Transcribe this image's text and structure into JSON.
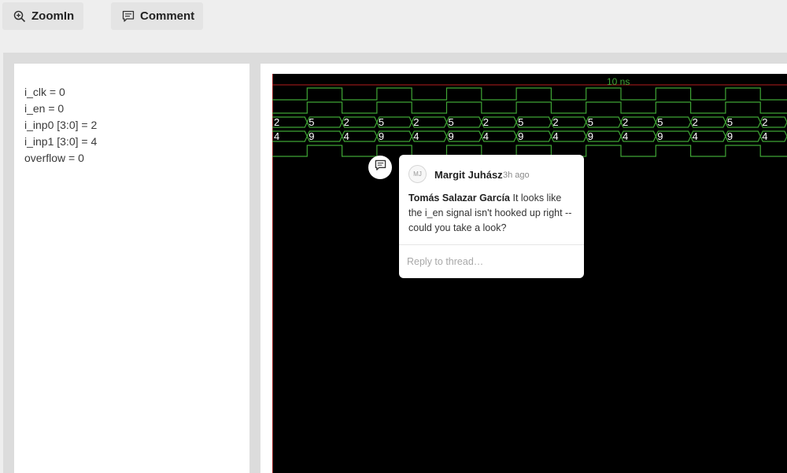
{
  "toolbar": {
    "zoom_label": "ZoomIn",
    "comment_label": "Comment"
  },
  "signals": [
    {
      "label": "i_clk = 0"
    },
    {
      "label": "i_en = 0"
    },
    {
      "label": "i_inp0 [3:0] = 2"
    },
    {
      "label": "i_inp1 [3:0] = 4"
    },
    {
      "label": "overflow = 0"
    }
  ],
  "waveform": {
    "time_marker_label": "10 ns",
    "trace_color": "#3fa535",
    "label_color": "#ffffff",
    "cursor_color": "#ff2a2a",
    "i_inp0_values": [
      "2",
      "5",
      "2",
      "5",
      "2",
      "5",
      "2",
      "5",
      "2",
      "5",
      "2",
      "5",
      "2",
      "5",
      "2"
    ],
    "i_inp1_values": [
      "4",
      "9",
      "4",
      "9",
      "4",
      "9",
      "4",
      "9",
      "4",
      "9",
      "4",
      "9",
      "4",
      "9",
      "4"
    ]
  },
  "comment": {
    "avatar_initials": "MJ",
    "author": "Margit Juhász",
    "timestamp": "3h ago",
    "mention": "Tomás Salazar García",
    "text": " It looks like the i_en signal isn't hooked up right -- could you take a look?",
    "reply_placeholder": "Reply to thread…"
  }
}
